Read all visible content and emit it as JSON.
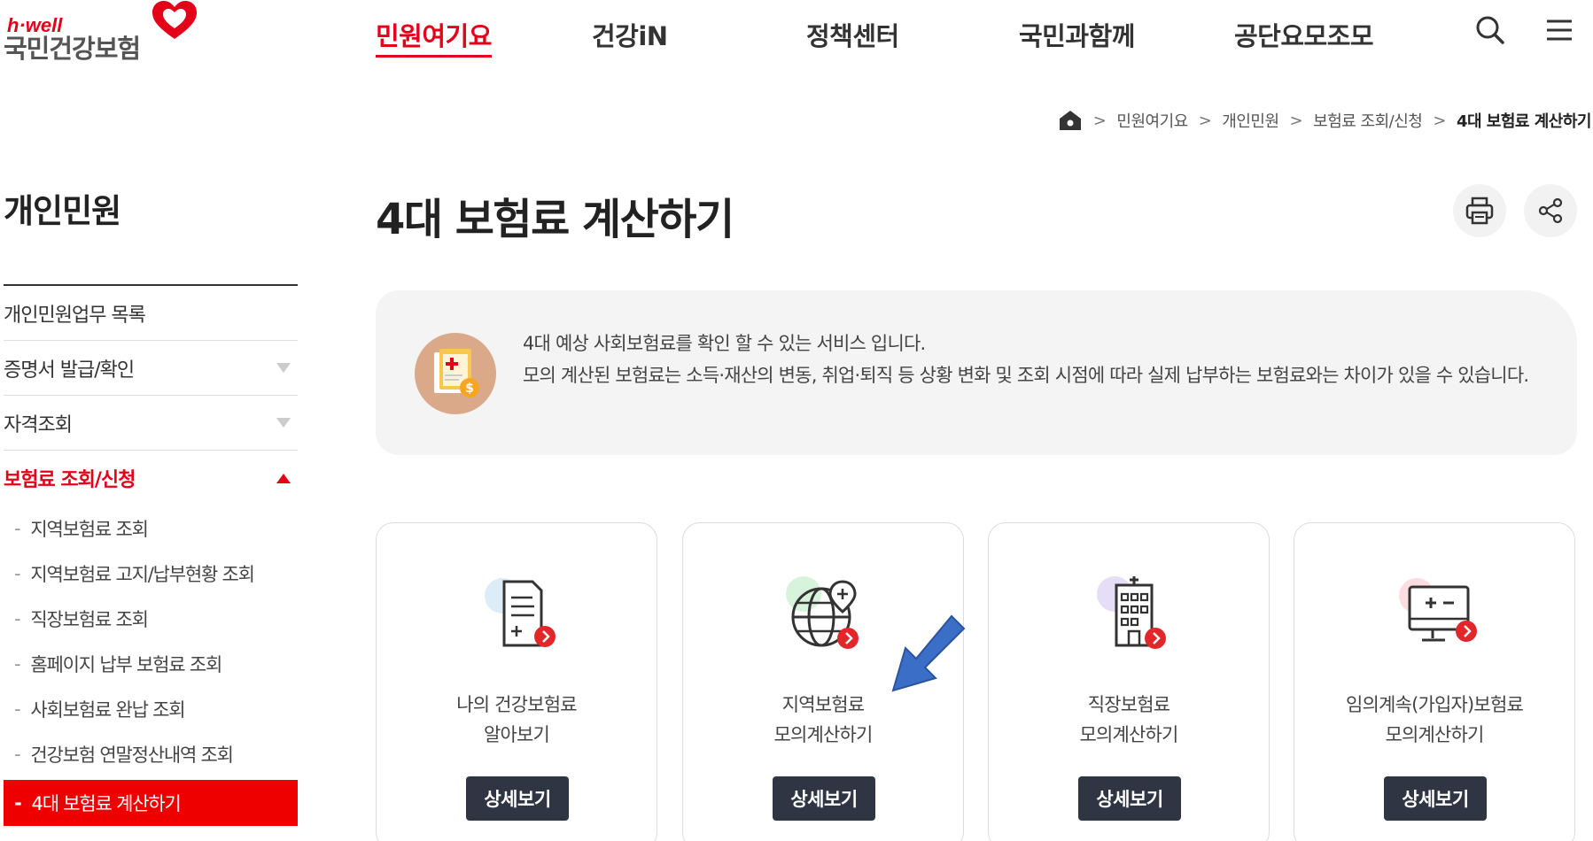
{
  "header": {
    "logo_small": "h·well",
    "logo_name": "국민건강보험",
    "nav": [
      {
        "label": "민원여기요",
        "active": true
      },
      {
        "label": "건강iN",
        "active": false
      },
      {
        "label": "정책센터",
        "active": false
      },
      {
        "label": "국민과함께",
        "active": false
      },
      {
        "label": "공단요모조모",
        "active": false
      }
    ],
    "icons": [
      "search-icon",
      "menu-icon"
    ]
  },
  "breadcrumb": {
    "home_icon": "home-icon",
    "items": [
      "민원여기요",
      "개인민원",
      "보험료 조회/신청",
      "4대 보험료 계산하기"
    ]
  },
  "sidebar": {
    "title": "개인민원",
    "items": [
      {
        "label": "개인민원업무 목록",
        "toggle": "none"
      },
      {
        "label": "증명서 발급/확인",
        "toggle": "down"
      },
      {
        "label": "자격조회",
        "toggle": "down"
      },
      {
        "label": "보험료 조회/신청",
        "toggle": "up",
        "active": true
      }
    ],
    "subitems": [
      {
        "label": "지역보험료 조회"
      },
      {
        "label": "지역보험료 고지/납부현황 조회"
      },
      {
        "label": "직장보험료 조회"
      },
      {
        "label": "홈페이지 납부 보험료 조회"
      },
      {
        "label": "사회보험료 완납 조회"
      },
      {
        "label": "건강보험 연말정산내역 조회"
      },
      {
        "label": "4대 보험료 계산하기",
        "active": true
      }
    ]
  },
  "main": {
    "title": "4대 보험료 계산하기",
    "actions": [
      "print-icon",
      "share-icon"
    ],
    "info": {
      "line1": "4대 예상 사회보험료를 확인 할 수 있는 서비스 입니다.",
      "line2": "모의 계산된 보험료는 소득·재산의 변동, 취업·퇴직 등 상황 변화 및 조회 시점에 따라 실제 납부하는 보험료와는 차이가 있을 수 있습니다."
    },
    "cards": [
      {
        "line1": "나의 건강보험료",
        "line2": "알아보기",
        "button": "상세보기",
        "icon": "document-icon"
      },
      {
        "line1": "지역보험료",
        "line2": "모의계산하기",
        "button": "상세보기",
        "icon": "globe-icon"
      },
      {
        "line1": "직장보험료",
        "line2": "모의계산하기",
        "button": "상세보기",
        "icon": "building-icon"
      },
      {
        "line1": "임의계속(가입자)보험료",
        "line2": "모의계산하기",
        "button": "상세보기",
        "icon": "calculator-monitor-icon"
      }
    ]
  },
  "colors": {
    "brand_red": "#e50019",
    "button_dark": "#2f3542",
    "annotation_arrow": "#3b6fc7"
  }
}
